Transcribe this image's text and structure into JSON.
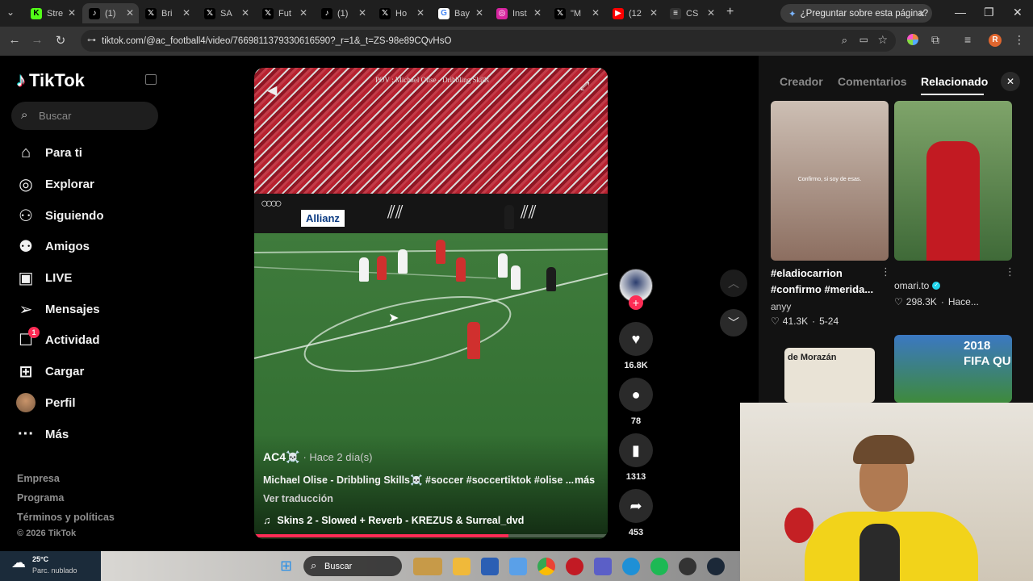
{
  "browser": {
    "tabs": [
      {
        "label": "Stre",
        "icon": "kick-icon"
      },
      {
        "label": "(1)",
        "icon": "tiktok-icon",
        "active": true
      },
      {
        "label": "Bri",
        "icon": "x-icon"
      },
      {
        "label": "SA",
        "icon": "x-icon"
      },
      {
        "label": "Fut",
        "icon": "x-icon"
      },
      {
        "label": "(1)",
        "icon": "tiktok-icon"
      },
      {
        "label": "Ho",
        "icon": "x-icon"
      },
      {
        "label": "Bay",
        "icon": "google-icon"
      },
      {
        "label": "Inst",
        "icon": "instagram-icon"
      },
      {
        "label": "\"M",
        "icon": "x-icon"
      },
      {
        "label": "(12",
        "icon": "youtube-icon"
      },
      {
        "label": "CS",
        "icon": "espn-icon"
      }
    ],
    "ask_label": "¿Preguntar sobre esta página?",
    "url": "tiktok.com/@ac_football4/video/7669811379330616590?_r=1&_t=ZS-98e89CQvHsO",
    "profile_initial": "R"
  },
  "sidebar": {
    "logo_text": "TikTok",
    "search_placeholder": "Buscar",
    "nav": [
      {
        "label": "Para ti",
        "icon": "home-icon"
      },
      {
        "label": "Explorar",
        "icon": "compass-icon"
      },
      {
        "label": "Siguiendo",
        "icon": "following-icon"
      },
      {
        "label": "Amigos",
        "icon": "friends-icon"
      },
      {
        "label": "LIVE",
        "icon": "live-icon"
      },
      {
        "label": "Mensajes",
        "icon": "messages-icon"
      },
      {
        "label": "Actividad",
        "icon": "activity-icon",
        "badge": "1"
      },
      {
        "label": "Cargar",
        "icon": "upload-icon"
      },
      {
        "label": "Perfil",
        "icon": "avatar-icon"
      },
      {
        "label": "Más",
        "icon": "more-icon"
      }
    ],
    "footer": [
      "Empresa",
      "Programa",
      "Términos y políticas",
      "© 2026 TikTok"
    ]
  },
  "video": {
    "overlay_text": "POV : Michael Olise - Dribbling Skills",
    "board_text": "Allianz",
    "author": "AC4☠️",
    "time": "· Hace 2 día(s)",
    "caption": "Michael Olise - Dribbling Skills☠️ #soccer #soccertiktok #olise ...",
    "more": "más",
    "translate": "Ver traducción",
    "music": "Skins 2 - Slowed + Reverb - KREZUS & Surreal_dvd",
    "progress": 0.72
  },
  "actions": {
    "likes": "16.8K",
    "comments": "78",
    "saves": "1313",
    "shares": "453"
  },
  "right_panel": {
    "tabs": [
      "Creador",
      "Comentarios",
      "Relacionado"
    ],
    "items": [
      {
        "thumb_text": "Confirmo, si soy de esas.",
        "title": "#eladiocarrion #confirmo #merida...",
        "author": "anyy",
        "likes": "41.3K",
        "date": "5-24"
      },
      {
        "thumb_text": "",
        "title": "omari.to",
        "author": "",
        "likes": "298.3K",
        "date": "Hace..."
      },
      {
        "thumb_text": "de Morazán",
        "title": "",
        "author": "",
        "likes": "",
        "date": ""
      },
      {
        "thumb_text": "2018 FIFA QU",
        "title": "",
        "author": "",
        "likes": "",
        "date": ""
      }
    ]
  },
  "taskbar": {
    "weather_temp": "25°C",
    "weather_desc": "Parc. nublado",
    "search": "Buscar"
  },
  "colors": {
    "accent": "#fe2c55",
    "bg": "#000000",
    "panel": "#121212"
  }
}
